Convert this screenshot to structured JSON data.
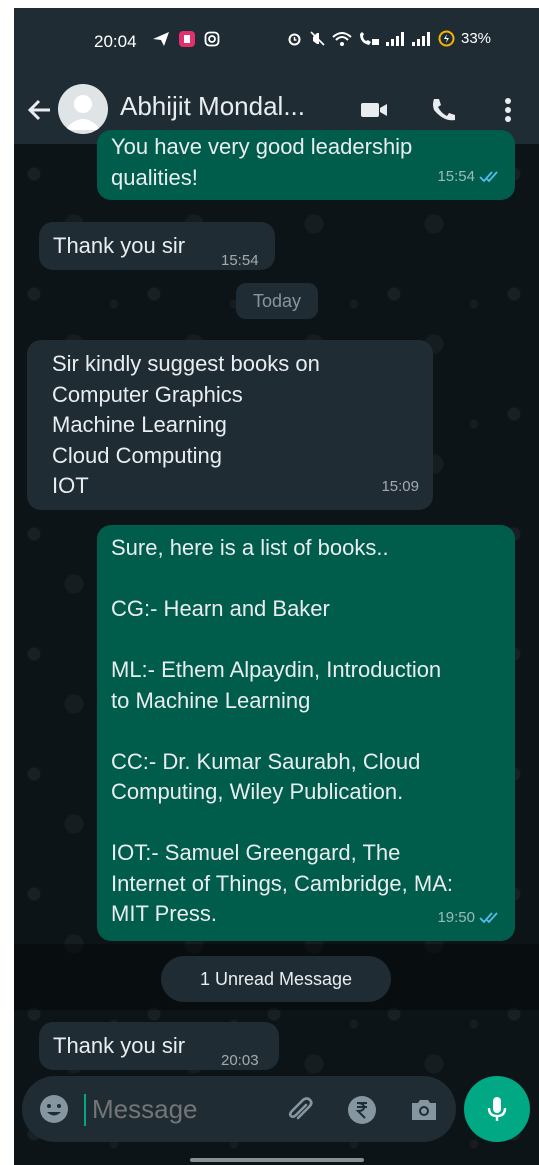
{
  "status_bar": {
    "time": "20:04",
    "battery": "33%",
    "left_icons": [
      "send-icon",
      "app-notification-icon",
      "instagram-icon"
    ],
    "right_icons": [
      "alarm-icon",
      "mute-icon",
      "wifi-icon",
      "wifi-call-icon",
      "signal-icon",
      "signal-icon",
      "battery-saver-icon"
    ]
  },
  "header": {
    "contact_name": "Abhijit Mondal...",
    "icons": [
      "back-arrow-icon",
      "avatar-icon",
      "video-call-icon",
      "voice-call-icon",
      "more-options-icon"
    ]
  },
  "messages": [
    {
      "direction": "outgoing",
      "lines": [
        "You have very good leadership",
        "qualities!"
      ],
      "time": "15:54",
      "status": "read"
    },
    {
      "direction": "incoming",
      "lines": [
        "Thank you sir"
      ],
      "time": "15:54"
    },
    {
      "type": "date",
      "label": "Today"
    },
    {
      "direction": "incoming",
      "lines": [
        "Sir kindly suggest books on",
        "Computer Graphics",
        "Machine Learning",
        "Cloud Computing",
        "IOT"
      ],
      "time": "15:09"
    },
    {
      "direction": "outgoing",
      "lines": [
        "Sure, here is a list of books..",
        "",
        "CG:- Hearn and Baker",
        "",
        "ML:- Ethem Alpaydin, Introduction",
        "to Machine Learning",
        "",
        "CC:- Dr. Kumar Saurabh, Cloud",
        "Computing, Wiley Publication.",
        "",
        "IOT:- Samuel Greengard, The",
        "Internet of Things, Cambridge, MA:",
        "MIT Press."
      ],
      "time": "19:50",
      "status": "read"
    },
    {
      "type": "unread",
      "label": "1 Unread Message"
    },
    {
      "direction": "incoming",
      "lines": [
        "Thank you sir"
      ],
      "time": "20:03"
    }
  ],
  "composer": {
    "placeholder": "Message",
    "icons": [
      "emoji-icon",
      "attach-icon",
      "rupee-payment-icon",
      "camera-icon",
      "mic-icon"
    ]
  },
  "colors": {
    "header_bg": "#1f2c34",
    "incoming_bubble": "#1f2c34",
    "outgoing_bubble": "#005c4b",
    "accent": "#00a884",
    "read_ticks": "#53bdeb"
  }
}
